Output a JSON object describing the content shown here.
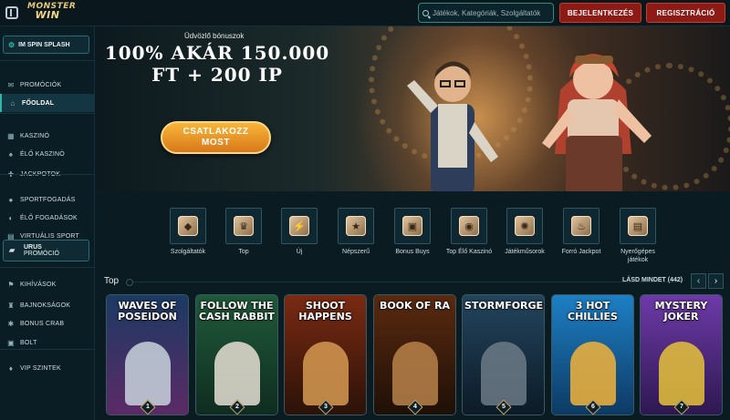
{
  "topbar": {
    "logo_line1": "MONSTER",
    "logo_line2": "WIN",
    "search_placeholder": "Játékok, Kategóriák, Szolgáltatók",
    "login_label": "BEJELENTKEZÉS",
    "register_label": "REGISZTRÁCIÓ"
  },
  "sidebar": {
    "promo_top": "IM SPIN SPLASH",
    "group1": [
      {
        "label": "PROMÓCIÓK",
        "icon": "gift-icon"
      },
      {
        "label": "FŐOLDAL",
        "icon": "home-icon"
      }
    ],
    "group2": [
      {
        "label": "KASZINÓ",
        "icon": "slot-icon"
      },
      {
        "label": "ÉLŐ KASZINÓ",
        "icon": "live-casino-icon"
      },
      {
        "label": "JACKPOTOK",
        "icon": "jackpot-icon"
      }
    ],
    "group3": [
      {
        "label": "SPORTFOGADÁS",
        "icon": "ball-icon"
      },
      {
        "label": "ÉLŐ FOGADÁSOK",
        "icon": "live-bet-icon"
      },
      {
        "label": "VIRTUÁLIS SPORT",
        "icon": "virtual-sport-icon"
      }
    ],
    "promo_mid_line1": "URUS",
    "promo_mid_line2": "PROMÓCIÓ",
    "group4": [
      {
        "label": "KIHÍVÁSOK",
        "icon": "challenge-icon"
      },
      {
        "label": "BAJNOKSÁGOK",
        "icon": "trophy-icon"
      },
      {
        "label": "BONUS CRAB",
        "icon": "crab-icon"
      },
      {
        "label": "BOLT",
        "icon": "shop-icon"
      }
    ],
    "group5": [
      {
        "label": "VIP SZINTEK",
        "icon": "vip-icon"
      }
    ],
    "active": "FŐOLDAL"
  },
  "hero": {
    "subtitle": "Üdvözlő bónuszok",
    "title_line1": "100% AKÁR 150.000",
    "title_line2": "FT + 200 IP",
    "cta_line1": "CSATLAKOZZ",
    "cta_line2": "MOST"
  },
  "categories": [
    {
      "label": "Szolgáltatók",
      "icon": "provider-icon",
      "glyph": "◆"
    },
    {
      "label": "Top",
      "icon": "crown-icon",
      "glyph": "♛"
    },
    {
      "label": "Új",
      "icon": "lightning-icon",
      "glyph": "⚡"
    },
    {
      "label": "Népszerű",
      "icon": "star-icon",
      "glyph": "★"
    },
    {
      "label": "Bonus Buys",
      "icon": "treasure-icon",
      "glyph": "▣"
    },
    {
      "label": "Top Élő Kaszinó",
      "icon": "poker-chip-icon",
      "glyph": "◉"
    },
    {
      "label": "Játékműsorok",
      "icon": "wheel-icon",
      "glyph": "✺"
    },
    {
      "label": "Forró Jackpot",
      "icon": "flame-icon",
      "glyph": "♨"
    },
    {
      "label": "Nyerőgépes játékok",
      "icon": "slot-machine-icon",
      "glyph": "▤"
    }
  ],
  "section": {
    "title": "Top",
    "see_all": "LÁSD MINDET (442)"
  },
  "games": [
    {
      "title": "WAVES OF POSEIDON",
      "rank": "1",
      "bg": "#1b3a63",
      "bg2": "#5c2a66",
      "char": "#c9d4dd"
    },
    {
      "title": "FOLLOW THE CASH RABBIT",
      "rank": "2",
      "bg": "#1f5a3a",
      "bg2": "#0f2c20",
      "char": "#e6dfd4"
    },
    {
      "title": "SHOOT HAPPENS",
      "rank": "3",
      "bg": "#7a2a12",
      "bg2": "#2b1208",
      "char": "#d69a52"
    },
    {
      "title": "BOOK OF RA",
      "rank": "4",
      "bg": "#5a2a10",
      "bg2": "#1e0f06",
      "char": "#b9824a"
    },
    {
      "title": "STORMFORGED",
      "rank": "5",
      "bg": "#23455e",
      "bg2": "#0c1a26",
      "char": "#6c7a86"
    },
    {
      "title": "3 HOT CHILLIES",
      "rank": "6",
      "bg": "#1d7fc4",
      "bg2": "#0d3a64",
      "char": "#f2b33a"
    },
    {
      "title": "MYSTERY JOKER",
      "rank": "7",
      "bg": "#6d3aa8",
      "bg2": "#2e1850",
      "char": "#e6c23a"
    }
  ]
}
